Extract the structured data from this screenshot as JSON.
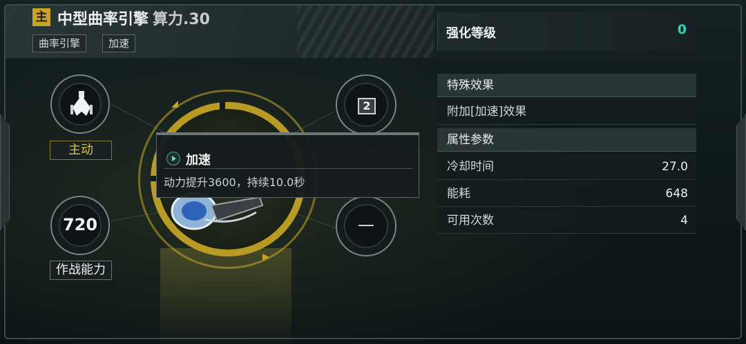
{
  "header": {
    "main_tag": "主",
    "title": "中型曲率引擎",
    "power_label": "算力.30",
    "tags": [
      "曲率引擎",
      "加速"
    ]
  },
  "left_panel": {
    "skill_type_label": "主动",
    "combat_value": "720",
    "combat_label": "作战能力"
  },
  "right_circles": {
    "slot_number": "2",
    "spec_label": "规格",
    "empty_value": "—"
  },
  "tooltip": {
    "title": "加速",
    "description": "动力提升3600，持续10.0秒"
  },
  "enhance": {
    "label": "强化等级",
    "value": "0"
  },
  "special_effects": {
    "header": "特殊效果",
    "items": [
      "附加[加速]效果"
    ]
  },
  "attributes": {
    "header": "属性参数",
    "rows": [
      {
        "key": "冷却时间",
        "value": "27.0"
      },
      {
        "key": "能耗",
        "value": "648"
      },
      {
        "key": "可用次数",
        "value": "4"
      }
    ]
  },
  "colors": {
    "accent_gold": "#c9a227",
    "accent_teal": "#2fd6b4"
  }
}
